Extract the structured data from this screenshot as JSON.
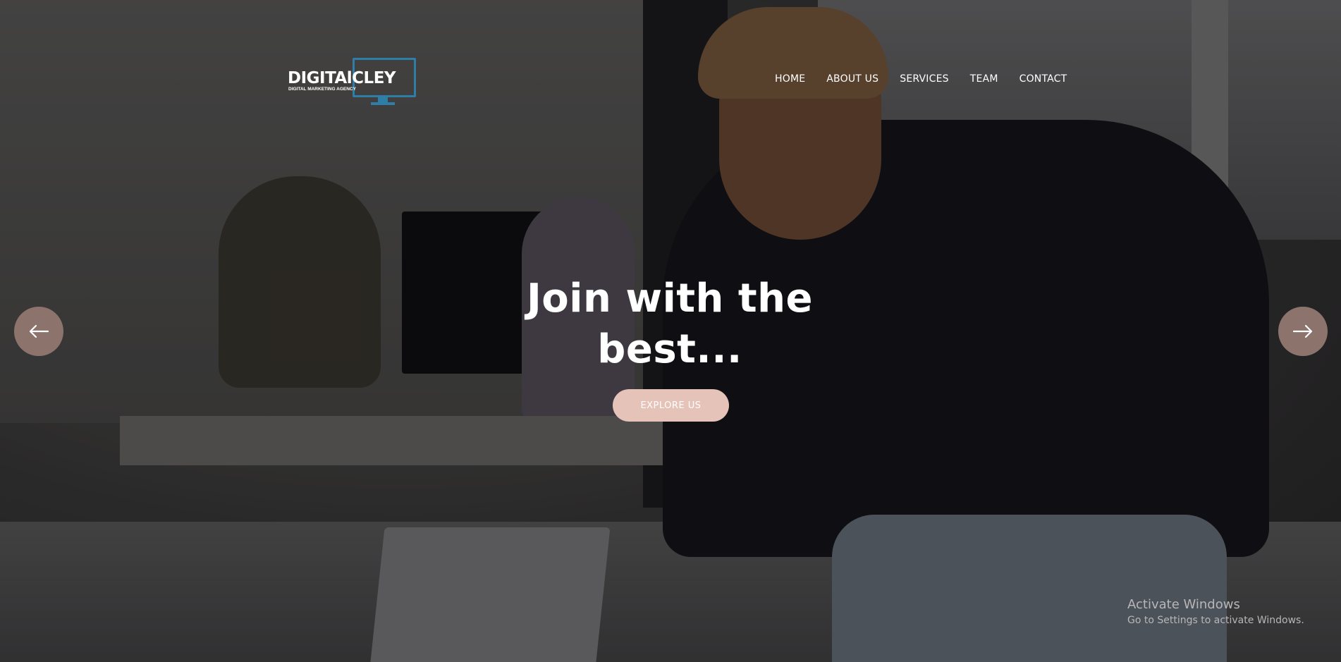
{
  "logo": {
    "text": "DIGITAlCLEY",
    "subtitle": "DIGITAL MARKETING AGENCY",
    "color": "#2f7ea8"
  },
  "nav": {
    "items": [
      "HOME",
      "ABOUT US",
      "SERVICES",
      "TEAM",
      "CONTACT"
    ]
  },
  "hero": {
    "headline_line1": "Join with the",
    "headline_line2": "best...",
    "cta_label": "EXPLORE US",
    "cta_color": "#e6c3b8",
    "prev_icon": "arrow-left-icon",
    "next_icon": "arrow-right-icon",
    "arrow_color": "#8c746d"
  },
  "watermark": {
    "title": "Activate Windows",
    "subtitle": "Go to Settings to activate Windows."
  }
}
